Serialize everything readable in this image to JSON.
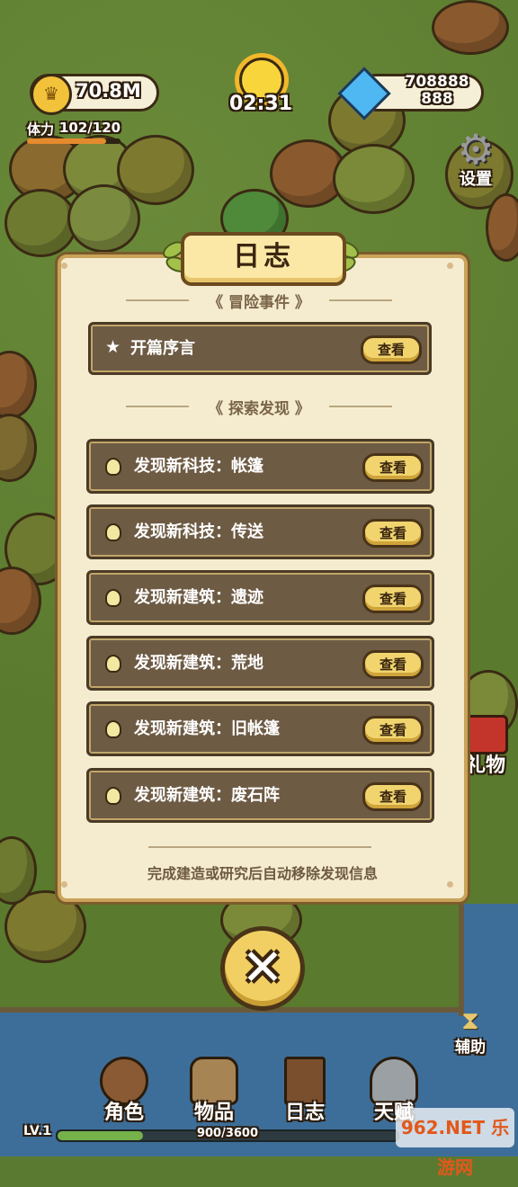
{
  "hud": {
    "gold": "70.8M",
    "stamina_label": "体力",
    "stamina_value": "102/120",
    "stamina_fraction": 0.85,
    "timer": "02:31",
    "gems_line1": "708888",
    "gems_line2": "888",
    "settings_label": "设置",
    "gift_label": "礼物",
    "assist_label": "辅助"
  },
  "dialog": {
    "title": "日志",
    "section_events": "冒险事件",
    "section_discoveries": "探索发现",
    "view_label": "查看",
    "events": [
      {
        "label": "开篇序言"
      }
    ],
    "discoveries": [
      {
        "label": "发现新科技：帐篷"
      },
      {
        "label": "发现新科技：传送"
      },
      {
        "label": "发现新建筑：遗迹"
      },
      {
        "label": "发现新建筑：荒地"
      },
      {
        "label": "发现新建筑：旧帐篷"
      },
      {
        "label": "发现新建筑：废石阵"
      }
    ],
    "footer_note": "完成建造或研究后自动移除发现信息"
  },
  "nav": {
    "items": [
      {
        "label": "角色",
        "icon": "character-icon"
      },
      {
        "label": "物品",
        "icon": "bag-icon"
      },
      {
        "label": "日志",
        "icon": "journal-icon"
      },
      {
        "label": "天赋",
        "icon": "talent-icon"
      }
    ],
    "level": "LV.1",
    "xp": "900/3600",
    "xp_fraction": 0.25
  },
  "watermark": "962.NET 乐游网",
  "colors": {
    "panel": "#f5ecd0",
    "row": "#6e5b44",
    "button": "#f1d46e",
    "grass": "#5a7a2e",
    "water": "#3d6e99"
  }
}
